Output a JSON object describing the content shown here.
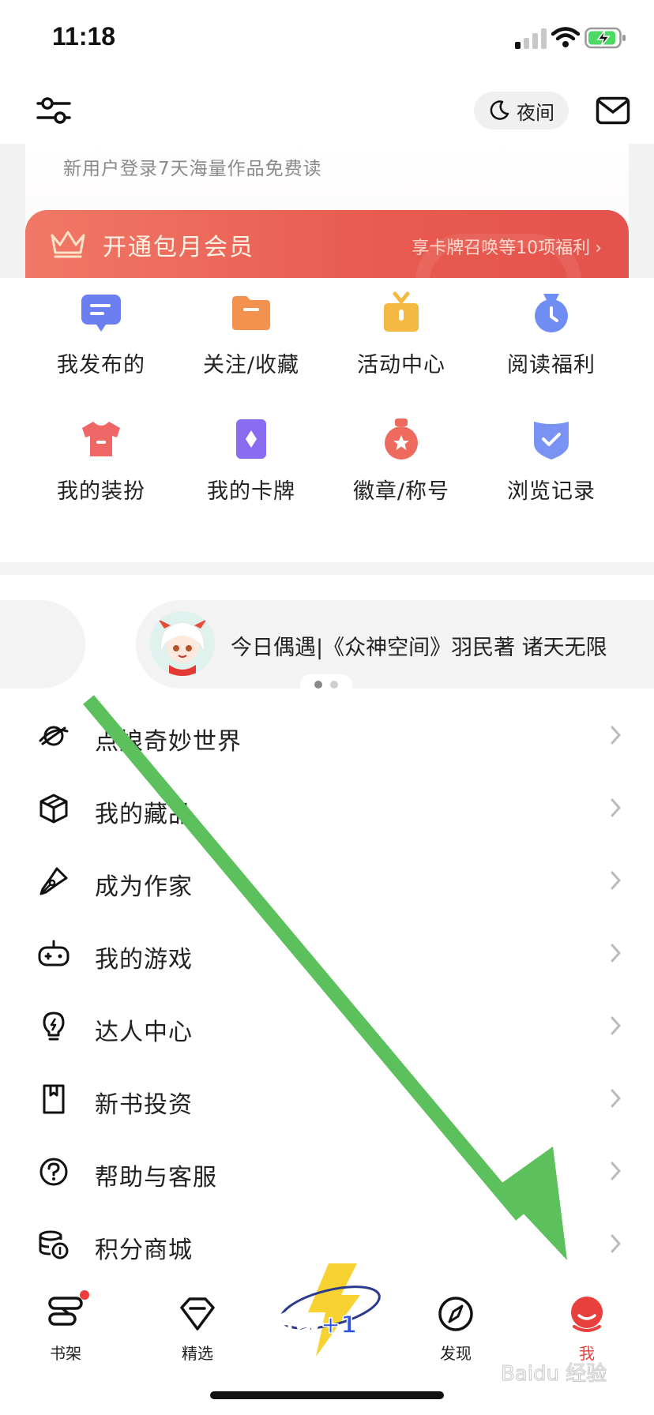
{
  "status_bar": {
    "time": "11:18"
  },
  "toolbar": {
    "night_label": "夜间"
  },
  "header": {
    "promo_text": "新用户登录7天海量作品免费读",
    "vip_title": "开通包月会员",
    "vip_benefit": "享卡牌召唤等10项福利"
  },
  "grid": {
    "items": [
      {
        "label": "我发布的",
        "icon": "message-icon",
        "color": "#6b7ff0"
      },
      {
        "label": "关注/收藏",
        "icon": "folder-icon",
        "color": "#f2924e"
      },
      {
        "label": "活动中心",
        "icon": "gift-icon",
        "color": "#f5b843"
      },
      {
        "label": "阅读福利",
        "icon": "clock-bag-icon",
        "color": "#6f8df2"
      },
      {
        "label": "我的装扮",
        "icon": "tshirt-icon",
        "color": "#ef6666"
      },
      {
        "label": "我的卡牌",
        "icon": "card-icon",
        "color": "#8a6cf0"
      },
      {
        "label": "徽章/称号",
        "icon": "medal-icon",
        "color": "#ee6a5e"
      },
      {
        "label": "浏览记录",
        "icon": "history-shield-icon",
        "color": "#7a93f2"
      }
    ]
  },
  "carousel": {
    "text": "今日偶遇|《众神空间》羽民著 诸天无限",
    "pages": 2,
    "active_page": 1
  },
  "menu": {
    "items": [
      {
        "label": "点娘奇妙世界",
        "icon": "planet-icon"
      },
      {
        "label": "我的藏品",
        "icon": "cube-icon"
      },
      {
        "label": "成为作家",
        "icon": "pen-icon"
      },
      {
        "label": "我的游戏",
        "icon": "gamepad-icon"
      },
      {
        "label": "达人中心",
        "icon": "lightbulb-icon"
      },
      {
        "label": "新书投资",
        "icon": "bookmark-icon"
      },
      {
        "label": "帮助与客服",
        "icon": "help-icon"
      },
      {
        "label": "积分商城",
        "icon": "coins-icon"
      }
    ]
  },
  "tabbar": {
    "tabs": [
      {
        "label": "书架",
        "icon": "bookshelf-icon",
        "badge": true
      },
      {
        "label": "精选",
        "icon": "diamond-icon"
      },
      {
        "label": "发现",
        "icon": "compass-icon"
      },
      {
        "label": "我",
        "icon": "profile-icon",
        "active": true
      }
    ],
    "promo_text": "升级+1"
  },
  "colors": {
    "accent": "#e8403c",
    "vip_gradient_start": "#f07866",
    "vip_gradient_end": "#e4534c",
    "annotation_arrow": "#5cc05c"
  },
  "watermark": "Baidu 经验"
}
